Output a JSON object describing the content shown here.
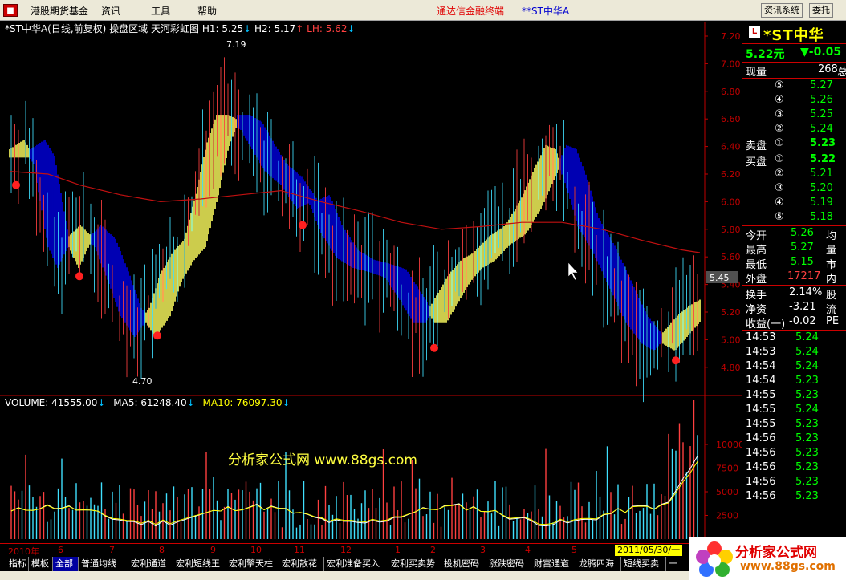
{
  "menubar": {
    "items": [
      "港股期货基金",
      "资讯",
      "工具",
      "帮助"
    ],
    "title": "通达信金融终端",
    "stock": "*ST中华A",
    "btn_news": "资讯系统",
    "btn_trade": "委托"
  },
  "chart": {
    "header": {
      "name": "*ST中华A(日线,前复权)",
      "indicator": "操盘区域",
      "subtitle": "天河彩虹图",
      "h1_label": "H1:",
      "h1_value": "5.25",
      "h2_label": "H2:",
      "h2_value": "5.17",
      "lh_label": "LH:",
      "lh_value": "5.62"
    },
    "high_label": "7.19",
    "low_label": "4.70",
    "current_price_tag": "5.45",
    "price_ticks": [
      "7.20",
      "7.00",
      "6.80",
      "6.60",
      "6.40",
      "6.20",
      "6.00",
      "5.80",
      "5.60",
      "5.40",
      "5.20",
      "5.00",
      "4.80"
    ],
    "volume_header": {
      "volume_label": "VOLUME:",
      "volume_value": "41555.00",
      "ma5_label": "MA5:",
      "ma5_value": "61248.40",
      "ma10_label": "MA10:",
      "ma10_value": "76097.30"
    },
    "volume_ticks": [
      "10000",
      "7500",
      "5000",
      "2500"
    ],
    "watermark": "分析家公式网 www.88gs.com",
    "time_ticks": [
      "2010年",
      "6",
      "7",
      "8",
      "9",
      "10",
      "11",
      "12",
      "1",
      "2",
      "3",
      "4",
      "5"
    ],
    "date_box": "2011/05/30/一",
    "colors": {
      "up": "#ffff60",
      "down": "#0000e0",
      "ma": "#c01010",
      "grid": "#c00000"
    }
  },
  "panel": {
    "badge": "L",
    "stock_name": "*ST中华",
    "price": "5.22元",
    "change": "▼-0.05",
    "volume_label": "现量",
    "volume_value": "268",
    "volume_total": "总",
    "sell_levels": [
      {
        "n": "⑤",
        "p": "5.27"
      },
      {
        "n": "④",
        "p": "5.26"
      },
      {
        "n": "③",
        "p": "5.25"
      },
      {
        "n": "②",
        "p": "5.24"
      }
    ],
    "sell1_label": "卖盘",
    "sell1_n": "①",
    "sell1_p": "5.23",
    "buy1_label": "买盘",
    "buy1_n": "①",
    "buy1_p": "5.22",
    "buy_levels": [
      {
        "n": "②",
        "p": "5.21"
      },
      {
        "n": "③",
        "p": "5.20"
      },
      {
        "n": "④",
        "p": "5.19"
      },
      {
        "n": "⑤",
        "p": "5.18"
      }
    ],
    "stats": [
      {
        "k": "今开",
        "v": "5.26",
        "k2": "均"
      },
      {
        "k": "最高",
        "v": "5.27",
        "k2": "量"
      },
      {
        "k": "最低",
        "v": "5.15",
        "k2": "市"
      },
      {
        "k": "外盘",
        "v": "17217",
        "k2": "内"
      }
    ],
    "stats2": [
      {
        "k": "换手",
        "v": "2.14%",
        "k2": "股"
      },
      {
        "k": "净资",
        "v": "-3.21",
        "k2": "流"
      },
      {
        "k": "收益(一)",
        "v": "-0.02",
        "k2": "PE"
      }
    ],
    "ticks": [
      {
        "t": "14:53",
        "p": "5.24"
      },
      {
        "t": "14:53",
        "p": "5.24"
      },
      {
        "t": "14:54",
        "p": "5.24"
      },
      {
        "t": "14:54",
        "p": "5.23"
      },
      {
        "t": "14:55",
        "p": "5.23"
      },
      {
        "t": "14:55",
        "p": "5.24"
      },
      {
        "t": "14:55",
        "p": "5.23"
      },
      {
        "t": "14:56",
        "p": "5.23"
      },
      {
        "t": "14:56",
        "p": "5.23"
      },
      {
        "t": "14:56",
        "p": "5.23"
      },
      {
        "t": "14:56",
        "p": "5.23"
      },
      {
        "t": "14:56",
        "p": "5.23"
      }
    ]
  },
  "tabs": [
    "指标",
    "模板",
    "全部",
    "普通均线",
    "宏利通道",
    "宏利短线王",
    "宏利擎天柱",
    "宏利散花",
    "宏利准备买入",
    "宏利买卖势",
    "投机密码",
    "涨跌密码",
    "财富通道",
    "龙腾四海",
    "短线买卖",
    "一"
  ],
  "logo": {
    "line1": "分析家公式网",
    "line2": "www.88gs.com"
  }
}
